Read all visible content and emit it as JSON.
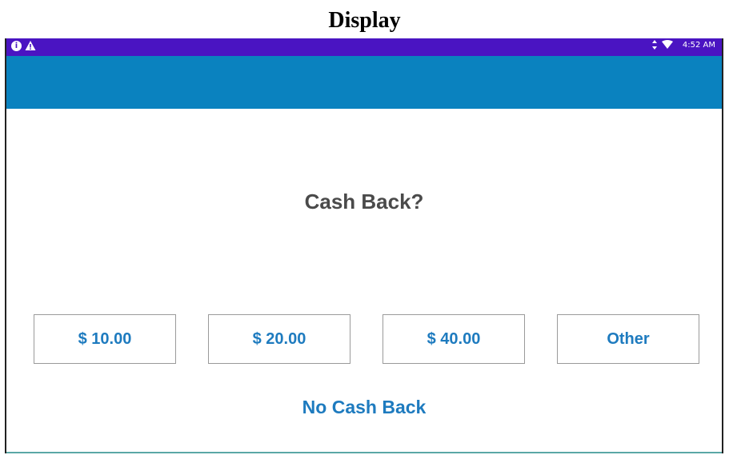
{
  "caption": "Display",
  "status_bar": {
    "time": "4:52 AM",
    "icons": [
      "info-icon",
      "warning-icon",
      "signal-icon",
      "wifi-icon"
    ],
    "color": "#4a14c2"
  },
  "app_bar": {
    "color": "#0a82bf"
  },
  "prompt": "Cash Back?",
  "options": [
    {
      "label": "$ 10.00"
    },
    {
      "label": "$ 20.00"
    },
    {
      "label": "$ 40.00"
    },
    {
      "label": "Other"
    }
  ],
  "no_cash_back_label": "No Cash Back",
  "accent_color": "#1e7bbf"
}
